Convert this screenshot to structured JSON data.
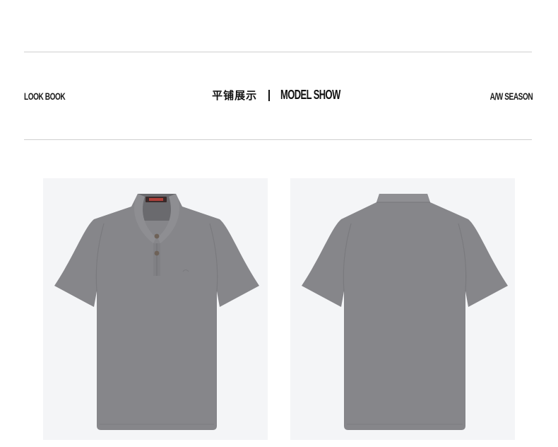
{
  "header": {
    "left_label": "LOOK BOOK",
    "center_cn": "平铺展示",
    "center_en": "MODEL SHOW",
    "right_label": "A/W SEASON"
  },
  "products": [
    {
      "view": "front",
      "color": "#86868a",
      "collar_inner": "#6f6f73",
      "neck_tag": "#3a2a2a"
    },
    {
      "view": "back",
      "color": "#86868a"
    }
  ],
  "icons": {
    "front_shirt": "polo-shirt-front-icon",
    "back_shirt": "polo-shirt-back-icon"
  }
}
